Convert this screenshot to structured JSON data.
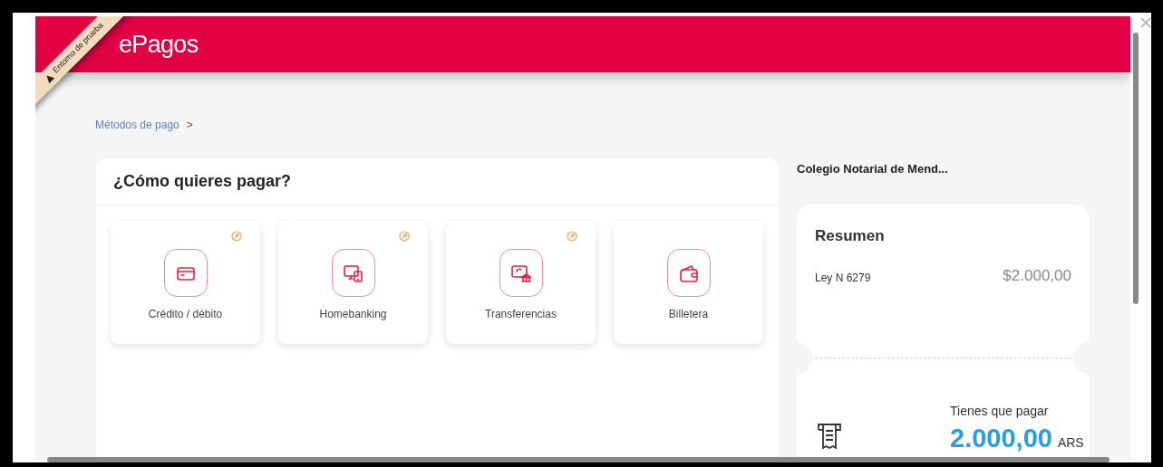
{
  "header": {
    "logo": "ePagos",
    "ribbon": "Entorno de prueba"
  },
  "breadcrumb": {
    "link": "Métodos de pago",
    "separator": ">"
  },
  "methods_panel": {
    "title": "¿Cómo quieres pagar?",
    "methods": [
      {
        "kind": "card",
        "label": "Crédito / débito",
        "promo": true
      },
      {
        "kind": "devices",
        "label": "Homebanking",
        "promo": true
      },
      {
        "kind": "transfer",
        "label": "Transferencias",
        "promo": true
      },
      {
        "kind": "wallet",
        "label": "Billetera",
        "promo": false
      }
    ]
  },
  "merchant": "Colegio Notarial de Mend...",
  "summary": {
    "title": "Resumen",
    "items": [
      {
        "concept": "Ley N 6279",
        "amount": "$2.000,00"
      }
    ],
    "total_label": "Tienes que pagar",
    "total": "2.000,00",
    "currency": "ARS"
  }
}
